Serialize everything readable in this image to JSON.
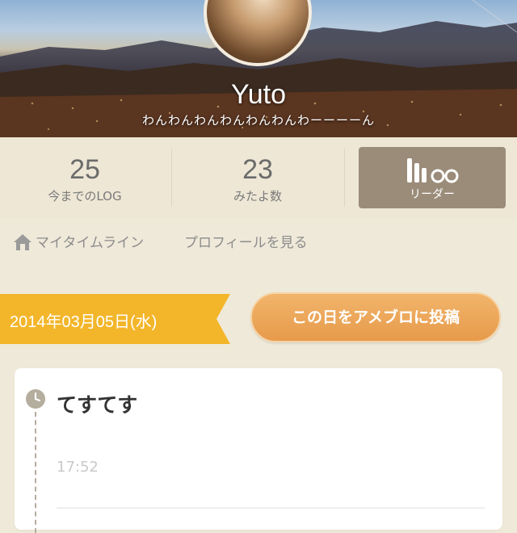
{
  "profile": {
    "username": "Yuto",
    "tagline": "わんわんわんわんわんわんわーーーーん"
  },
  "stats": [
    {
      "value": "25",
      "label": "今までのLOG"
    },
    {
      "value": "23",
      "label": "みたよ数"
    }
  ],
  "reader": {
    "label": "リーダー",
    "icon": "reader-icon"
  },
  "links": {
    "my_timeline": "マイタイムライン",
    "view_profile": "プロフィールを見る"
  },
  "date_banner": "2014年03月05日(水)",
  "post_button": "この日をアメブロに投稿",
  "log": {
    "title": "てすてす",
    "time": "17:52"
  },
  "colors": {
    "background": "#efe9d9",
    "banner_yellow": "#f3b62a",
    "post_orange": "#e79a4b",
    "reader_bg": "#9b8c7a"
  }
}
